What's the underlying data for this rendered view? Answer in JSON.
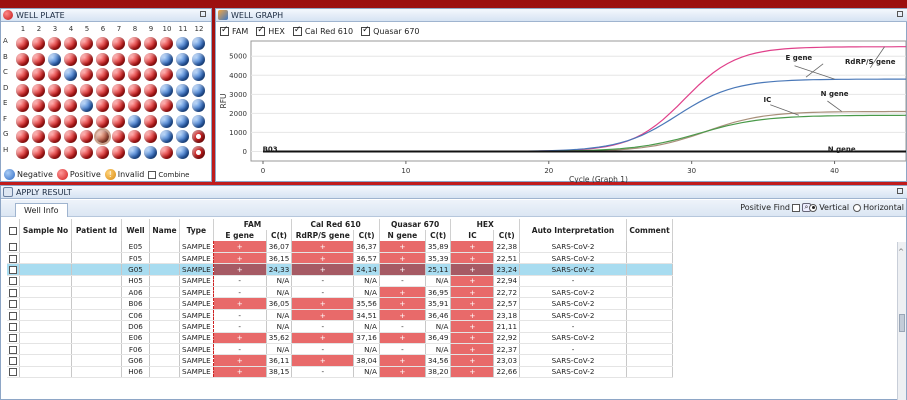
{
  "well_plate": {
    "title": "WELL PLATE",
    "columns": [
      "1",
      "2",
      "3",
      "4",
      "5",
      "6",
      "7",
      "8",
      "9",
      "10",
      "11",
      "12"
    ],
    "rows": [
      "A",
      "B",
      "C",
      "D",
      "E",
      "F",
      "G",
      "H"
    ],
    "grid": [
      [
        "pos",
        "pos",
        "pos",
        "pos",
        "pos",
        "pos",
        "pos",
        "pos",
        "pos",
        "pos",
        "neg",
        "neg"
      ],
      [
        "pos",
        "pos",
        "neg",
        "pos",
        "pos",
        "pos",
        "pos",
        "pos",
        "pos",
        "neg",
        "neg",
        "neg"
      ],
      [
        "pos",
        "pos",
        "pos",
        "neg",
        "pos",
        "pos",
        "pos",
        "pos",
        "pos",
        "pos",
        "neg",
        "neg"
      ],
      [
        "pos",
        "pos",
        "pos",
        "pos",
        "pos",
        "pos",
        "pos",
        "pos",
        "pos",
        "neg",
        "neg",
        "neg"
      ],
      [
        "pos",
        "pos",
        "pos",
        "pos",
        "neg",
        "pos",
        "pos",
        "pos",
        "pos",
        "pos",
        "neg",
        "neg"
      ],
      [
        "pos",
        "pos",
        "pos",
        "pos",
        "pos",
        "pos",
        "pos",
        "neg",
        "pos",
        "neg",
        "neg",
        "neg"
      ],
      [
        "pos",
        "pos",
        "pos",
        "pos",
        "pos",
        "sel",
        "pos",
        "pos",
        "pos",
        "neg",
        "neg",
        "ctl"
      ],
      [
        "pos",
        "pos",
        "pos",
        "pos",
        "pos",
        "pos",
        "pos",
        "neg",
        "neg",
        "pos",
        "neg",
        "ctl"
      ]
    ],
    "legend": {
      "negative": "Negative",
      "positive": "Positive",
      "invalid": "Invalid",
      "combine": "Combine"
    }
  },
  "well_graph": {
    "title": "WELL GRAPH",
    "dyes": [
      "FAM",
      "HEX",
      "Cal Red 610",
      "Quasar 670"
    ]
  },
  "chart_data": {
    "type": "line",
    "title": "",
    "xlabel": "Cycle (Graph 1)",
    "ylabel": "RFU",
    "xlim": [
      0,
      45
    ],
    "ylim": [
      -500,
      5800
    ],
    "x_ticks": [
      0,
      10,
      20,
      30,
      40
    ],
    "y_ticks": [
      0,
      1000,
      2000,
      3000,
      4000,
      5000
    ],
    "series": [
      {
        "name": "E gene",
        "color": "#e0408a",
        "baseline": 0,
        "plateau": 5500,
        "midpoint": 29.5,
        "slope": 0.55
      },
      {
        "name": "RdRP/S gene",
        "color": "#4a78b8",
        "baseline": 0,
        "plateau": 3800,
        "midpoint": 29,
        "slope": 0.5
      },
      {
        "name": "N gene",
        "color": "#a88f7a",
        "baseline": 0,
        "plateau": 2100,
        "midpoint": 31,
        "slope": 0.5
      },
      {
        "name": "IC",
        "color": "#4a9a4a",
        "baseline": 0,
        "plateau": 1900,
        "midpoint": 30.5,
        "slope": 0.45
      },
      {
        "name": "",
        "color": "#111111",
        "baseline": 0,
        "plateau": 0,
        "midpoint": 0,
        "slope": 0
      }
    ],
    "annotations": [
      {
        "text": "E gene",
        "x": 37.5,
        "y": 4800
      },
      {
        "text": "RdRP/S gene",
        "x": 42.5,
        "y": 4600
      },
      {
        "text": "N gene",
        "x": 40,
        "y": 2900
      },
      {
        "text": "IC",
        "x": 35.3,
        "y": 2600
      },
      {
        "text": "B03",
        "x": 0.5,
        "y": 0
      },
      {
        "text": "N gene",
        "x": 40.5,
        "y": 0
      }
    ]
  },
  "apply_result": {
    "title": "APPLY RESULT",
    "tab": "Well Info",
    "positive_find": "Positive Find",
    "orientation": {
      "vertical": "Vertical",
      "horizontal": "Horizontal"
    },
    "headers": {
      "sample_no": "Sample No",
      "patient_id": "Patient Id",
      "well": "Well",
      "name": "Name",
      "type": "Type",
      "fam": "FAM",
      "calred": "Cal Red 610",
      "quasar": "Quasar 670",
      "hex": "HEX",
      "e_gene": "E gene",
      "rdrp": "RdRP/S gene",
      "n_gene": "N gene",
      "ic": "IC",
      "ct": "C(t)",
      "auto": "Auto  Interpretation",
      "comment": "Comment"
    },
    "rows": [
      {
        "well": "E05",
        "type": "SAMPLE",
        "fam": "+",
        "fam_ct": "36,07",
        "cr": "+",
        "cr_ct": "36,37",
        "qs": "+",
        "qs_ct": "35,89",
        "hex": "+",
        "hex_ct": "22,38",
        "interp": "SARS-CoV-2"
      },
      {
        "well": "F05",
        "type": "SAMPLE",
        "fam": "+",
        "fam_ct": "36,15",
        "cr": "+",
        "cr_ct": "36,57",
        "qs": "+",
        "qs_ct": "35,39",
        "hex": "+",
        "hex_ct": "22,51",
        "interp": "SARS-CoV-2"
      },
      {
        "well": "G05",
        "type": "SAMPLE",
        "fam": "+",
        "fam_ct": "24,33",
        "cr": "+",
        "cr_ct": "24,14",
        "qs": "+",
        "qs_ct": "25,11",
        "hex": "+",
        "hex_ct": "23,24",
        "interp": "SARS-CoV-2",
        "selected": true
      },
      {
        "well": "H05",
        "type": "SAMPLE",
        "fam": "-",
        "fam_ct": "N/A",
        "cr": "-",
        "cr_ct": "N/A",
        "qs": "-",
        "qs_ct": "N/A",
        "hex": "+",
        "hex_ct": "22,94",
        "interp": "-"
      },
      {
        "well": "A06",
        "type": "SAMPLE",
        "fam": "-",
        "fam_ct": "N/A",
        "cr": "-",
        "cr_ct": "N/A",
        "qs": "+",
        "qs_ct": "36,95",
        "hex": "+",
        "hex_ct": "22,72",
        "interp": "SARS-CoV-2"
      },
      {
        "well": "B06",
        "type": "SAMPLE",
        "fam": "+",
        "fam_ct": "36,05",
        "cr": "+",
        "cr_ct": "35,56",
        "qs": "+",
        "qs_ct": "35,91",
        "hex": "+",
        "hex_ct": "22,57",
        "interp": "SARS-CoV-2"
      },
      {
        "well": "C06",
        "type": "SAMPLE",
        "fam": "-",
        "fam_ct": "N/A",
        "cr": "+",
        "cr_ct": "34,51",
        "qs": "+",
        "qs_ct": "36,46",
        "hex": "+",
        "hex_ct": "23,18",
        "interp": "SARS-CoV-2"
      },
      {
        "well": "D06",
        "type": "SAMPLE",
        "fam": "-",
        "fam_ct": "N/A",
        "cr": "-",
        "cr_ct": "N/A",
        "qs": "-",
        "qs_ct": "N/A",
        "hex": "+",
        "hex_ct": "21,11",
        "interp": "-"
      },
      {
        "well": "E06",
        "type": "SAMPLE",
        "fam": "+",
        "fam_ct": "35,62",
        "cr": "+",
        "cr_ct": "37,16",
        "qs": "+",
        "qs_ct": "36,49",
        "hex": "+",
        "hex_ct": "22,92",
        "interp": "SARS-CoV-2"
      },
      {
        "well": "F06",
        "type": "SAMPLE",
        "fam": "-",
        "fam_ct": "N/A",
        "cr": "-",
        "cr_ct": "N/A",
        "qs": "-",
        "qs_ct": "N/A",
        "hex": "+",
        "hex_ct": "22,37",
        "interp": "-"
      },
      {
        "well": "G06",
        "type": "SAMPLE",
        "fam": "+",
        "fam_ct": "36,11",
        "cr": "+",
        "cr_ct": "38,04",
        "qs": "+",
        "qs_ct": "34,56",
        "hex": "+",
        "hex_ct": "23,03",
        "interp": "SARS-CoV-2"
      },
      {
        "well": "H06",
        "type": "SAMPLE",
        "fam": "+",
        "fam_ct": "38,15",
        "cr": "-",
        "cr_ct": "N/A",
        "qs": "+",
        "qs_ct": "38,20",
        "hex": "+",
        "hex_ct": "22,66",
        "interp": "SARS-CoV-2"
      }
    ]
  },
  "colors": {
    "positive_cell": "#e86a6a",
    "selected_row": "#a8dcf0",
    "accent": "#b01515"
  }
}
